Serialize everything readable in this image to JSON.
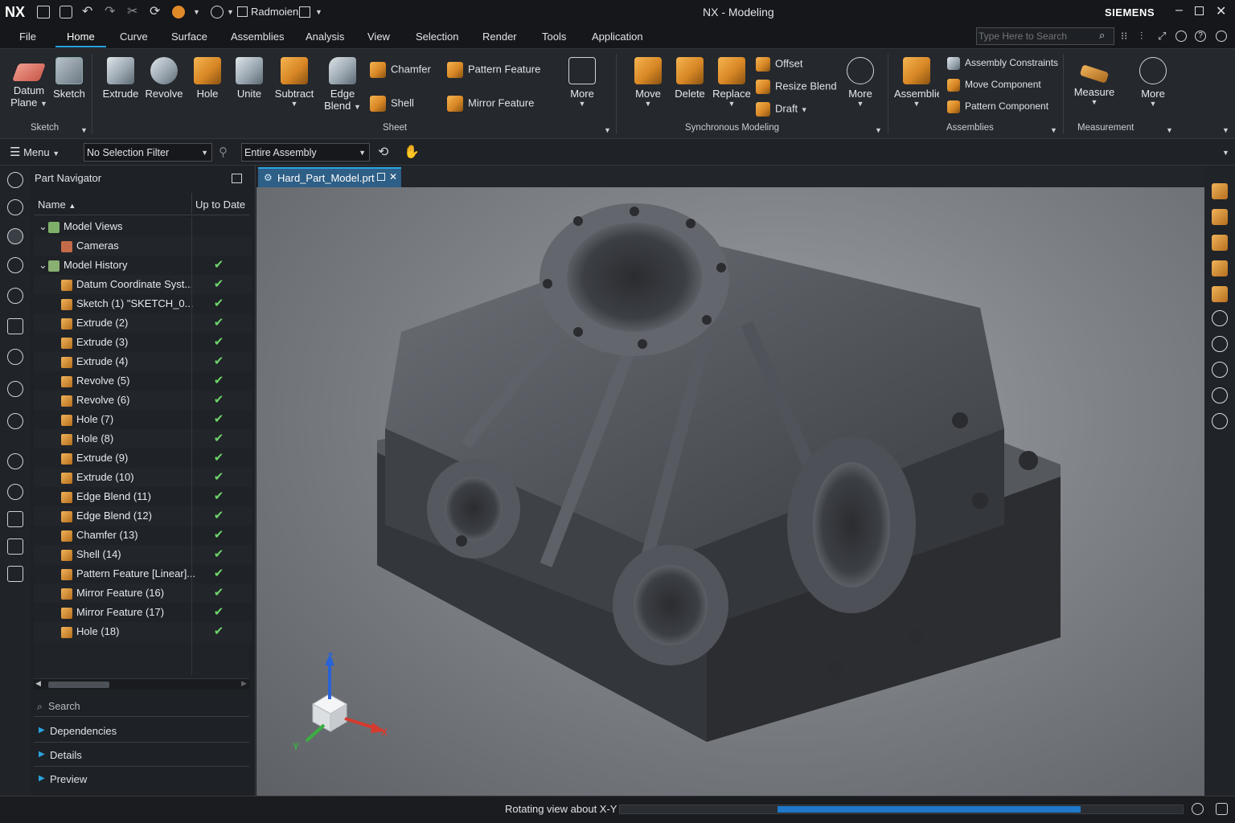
{
  "title_bar": {
    "app_logo": "NX",
    "window_title": "NX - Modeling",
    "brand": "SIEMENS",
    "quick_access_label": "Radmoien",
    "controls": [
      "minimize-icon",
      "maximize-icon",
      "close-icon"
    ]
  },
  "menu_tabs": [
    "File",
    "Home",
    "Curve",
    "Surface",
    "Assemblies",
    "Analysis",
    "View",
    "Selection",
    "Render",
    "Tools",
    "Application"
  ],
  "active_tab": "Home",
  "search": {
    "placeholder": "Type Here to Search"
  },
  "ribbon": {
    "sketch_group": {
      "label": "Sketch",
      "buttons": [
        {
          "label": "Datum",
          "label2": "Plane"
        },
        {
          "label": "Sketch"
        }
      ]
    },
    "sheet_group": {
      "label": "Sheet",
      "buttons": [
        {
          "label": "Extrude"
        },
        {
          "label": "Revolve"
        },
        {
          "label": "Hole"
        },
        {
          "label": "Unite"
        },
        {
          "label": "Subtract"
        },
        {
          "label": "Edge",
          "label2": "Blend"
        }
      ],
      "small_buttons": [
        "Chamfer",
        "Shell",
        "Pattern Feature",
        "Mirror Feature"
      ],
      "more": "More"
    },
    "sync_group": {
      "label": "Synchronous Modeling",
      "buttons": [
        {
          "label": "Move"
        },
        {
          "label": "Delete"
        },
        {
          "label": "Replace"
        }
      ],
      "small_buttons": [
        "Offset",
        "Resize Blend",
        "Draft"
      ],
      "more": "More"
    },
    "assemblies_group": {
      "label": "Assemblies",
      "button": "Assemblies",
      "small_buttons": [
        "Assembly Constraints",
        "Move Component",
        "Pattern Component"
      ]
    },
    "measurement_group": {
      "label": "Measurement",
      "button": "Measure",
      "more": "More"
    }
  },
  "selection_bar": {
    "menu": "Menu",
    "filter": "No Selection Filter",
    "scope": "Entire Assembly"
  },
  "navigator": {
    "title": "Part Navigator",
    "col_name": "Name",
    "col_status": "Up to Date",
    "rows": [
      {
        "label": "Model Views",
        "level": 0,
        "check": false
      },
      {
        "label": "Cameras",
        "level": 1,
        "check": false
      },
      {
        "label": "Model History",
        "level": 0,
        "check": true
      },
      {
        "label": "Datum Coordinate Syst...",
        "level": 1,
        "check": true
      },
      {
        "label": "Sketch (1) \"SKETCH_0...",
        "level": 1,
        "check": true
      },
      {
        "label": "Extrude (2)",
        "level": 1,
        "check": true
      },
      {
        "label": "Extrude (3)",
        "level": 1,
        "check": true
      },
      {
        "label": "Extrude (4)",
        "level": 1,
        "check": true
      },
      {
        "label": "Revolve (5)",
        "level": 1,
        "check": true
      },
      {
        "label": "Revolve (6)",
        "level": 1,
        "check": true
      },
      {
        "label": "Hole (7)",
        "level": 1,
        "check": true
      },
      {
        "label": "Hole (8)",
        "level": 1,
        "check": true
      },
      {
        "label": "Extrude (9)",
        "level": 1,
        "check": true
      },
      {
        "label": "Extrude (10)",
        "level": 1,
        "check": true
      },
      {
        "label": "Edge Blend (11)",
        "level": 1,
        "check": true
      },
      {
        "label": "Edge Blend (12)",
        "level": 1,
        "check": true
      },
      {
        "label": "Chamfer (13)",
        "level": 1,
        "check": true
      },
      {
        "label": "Shell (14)",
        "level": 1,
        "check": true
      },
      {
        "label": "Pattern Feature [Linear]...",
        "level": 1,
        "check": true
      },
      {
        "label": "Mirror Feature (16)",
        "level": 1,
        "check": true
      },
      {
        "label": "Mirror Feature (17)",
        "level": 1,
        "check": true
      },
      {
        "label": "Hole (18)",
        "level": 1,
        "check": true
      }
    ],
    "search": "Search",
    "sections": [
      "Dependencies",
      "Details",
      "Preview"
    ]
  },
  "document_tab": "Hard_Part_Model.prt",
  "triad": {
    "x": "X",
    "y": "Y",
    "z": "Z"
  },
  "status": {
    "message": "Rotating view about X-Y",
    "progress": 0.55
  },
  "colors": {
    "accent": "#29a3e0",
    "check": "#6ed36b",
    "feature_orange": "#e49a3b"
  }
}
